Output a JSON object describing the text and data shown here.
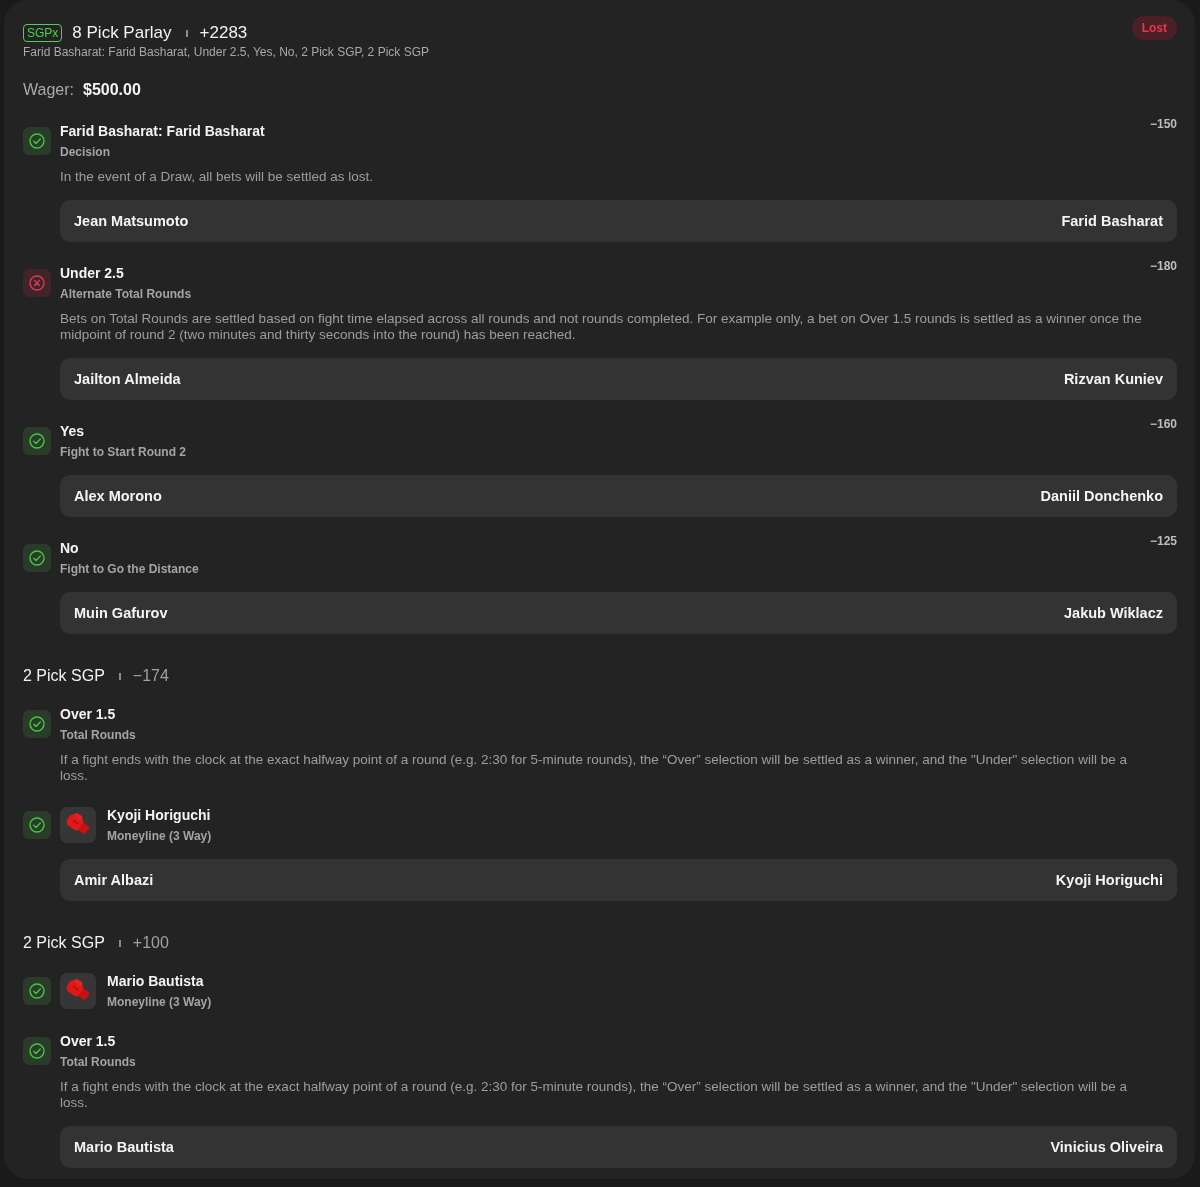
{
  "header": {
    "badge": "SGPx",
    "title": "8 Pick Parlay",
    "odds": "+2283",
    "summary": "Farid Basharat: Farid Basharat, Under 2.5, Yes, No, 2 Pick SGP, 2 Pick SGP",
    "status": "Lost"
  },
  "wager": {
    "label": "Wager:",
    "amount": "$500.00"
  },
  "sections": [
    {
      "legs": [
        {
          "kind": "prop",
          "won": true,
          "title": "Farid Basharat: Farid Basharat",
          "market": "Decision",
          "odds": "−150",
          "note": "In the event of a Draw, all bets will be settled as lost.",
          "matchup": [
            "Jean Matsumoto",
            "Farid Basharat"
          ]
        },
        {
          "kind": "prop",
          "won": false,
          "title": "Under 2.5",
          "market": "Alternate Total Rounds",
          "odds": "−180",
          "note": "Bets on Total Rounds are settled based on fight time elapsed across all rounds and not rounds completed. For example only, a bet on Over 1.5 rounds is settled as a winner once the midpoint of round 2 (two minutes and thirty seconds into the round) has been reached.",
          "matchup": [
            "Jailton Almeida",
            "Rizvan Kuniev"
          ]
        },
        {
          "kind": "prop",
          "won": true,
          "title": "Yes",
          "market": "Fight to Start Round 2",
          "odds": "−160",
          "matchup": [
            "Alex Morono",
            "Daniil Donchenko"
          ]
        },
        {
          "kind": "prop",
          "won": true,
          "title": "No",
          "market": "Fight to Go the Distance",
          "odds": "−125",
          "matchup": [
            "Muin Gafurov",
            "Jakub Wiklacz"
          ]
        }
      ]
    },
    {
      "title": "2 Pick SGP",
      "odds": "−174",
      "legs": [
        {
          "kind": "prop",
          "won": true,
          "title": "Over 1.5",
          "market": "Total Rounds",
          "note": "If a fight ends with the clock at the exact halfway point of a round (e.g. 2:30 for 5-minute rounds), the “Over” selection will be settled as a winner, and the \"Under\" selection will be a loss."
        },
        {
          "kind": "fighter",
          "won": true,
          "title": "Kyoji Horiguchi",
          "market": "Moneyline (3 Way)",
          "matchup": [
            "Amir Albazi",
            "Kyoji Horiguchi"
          ]
        }
      ]
    },
    {
      "title": "2 Pick SGP",
      "odds": "+100",
      "legs": [
        {
          "kind": "fighter",
          "won": true,
          "title": "Mario Bautista",
          "market": "Moneyline (3 Way)"
        },
        {
          "kind": "prop",
          "won": true,
          "title": "Over 1.5",
          "market": "Total Rounds",
          "note": "If a fight ends with the clock at the exact halfway point of a round (e.g. 2:30 for 5-minute rounds), the “Over” selection will be settled as a winner, and the \"Under\" selection will be a loss.",
          "matchup": [
            "Mario Bautista",
            "Vinicius Oliveira"
          ]
        }
      ]
    }
  ]
}
